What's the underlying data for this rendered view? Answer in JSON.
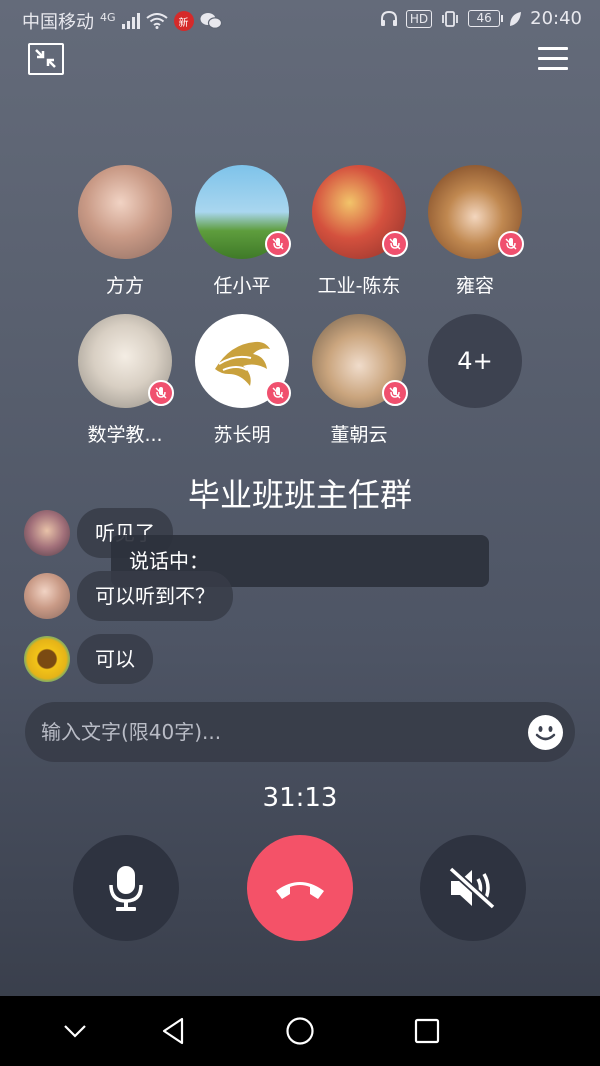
{
  "status_bar": {
    "carrier": "中国移动",
    "network": "4G",
    "weibo_badge": "新",
    "hd_label": "HD",
    "battery": "46",
    "time": "20:40"
  },
  "participants": [
    {
      "name": "方方",
      "muted": false,
      "avatar_color": "#c99a86"
    },
    {
      "name": "任小平",
      "muted": true,
      "avatar_color": "#6aa34a"
    },
    {
      "name": "工业-陈东",
      "muted": true,
      "avatar_color": "#c0463b"
    },
    {
      "name": "雍容",
      "muted": true,
      "avatar_color": "#a7762c"
    },
    {
      "name": "数学教...",
      "muted": true,
      "avatar_color": "#d8d2c8"
    },
    {
      "name": "苏长明",
      "muted": true,
      "avatar_color": "#ffffff"
    },
    {
      "name": "董朝云",
      "muted": true,
      "avatar_color": "#caa57e"
    }
  ],
  "more_participants": "4+",
  "group_title": "毕业班班主任群",
  "chat": [
    {
      "text": "听见了",
      "avatar_color": "#7a5a6e"
    },
    {
      "text": "可以听到不？",
      "avatar_color": "#c99a86"
    },
    {
      "text": "可以",
      "avatar_color": "#e5b318"
    }
  ],
  "speaking_label": "说话中：",
  "input": {
    "placeholder": "输入文字(限40字)...",
    "value": ""
  },
  "timer": "31:13",
  "colors": {
    "hangup": "#f45268",
    "mute_badge": "#f0506e",
    "control_bg": "#2e3340"
  },
  "icons": {
    "minimize": "minimize-icon",
    "menu": "menu-icon",
    "mic": "microphone-icon",
    "hangup": "phone-hangup-icon",
    "speaker": "speaker-muted-icon",
    "emoji": "emoji-icon"
  }
}
